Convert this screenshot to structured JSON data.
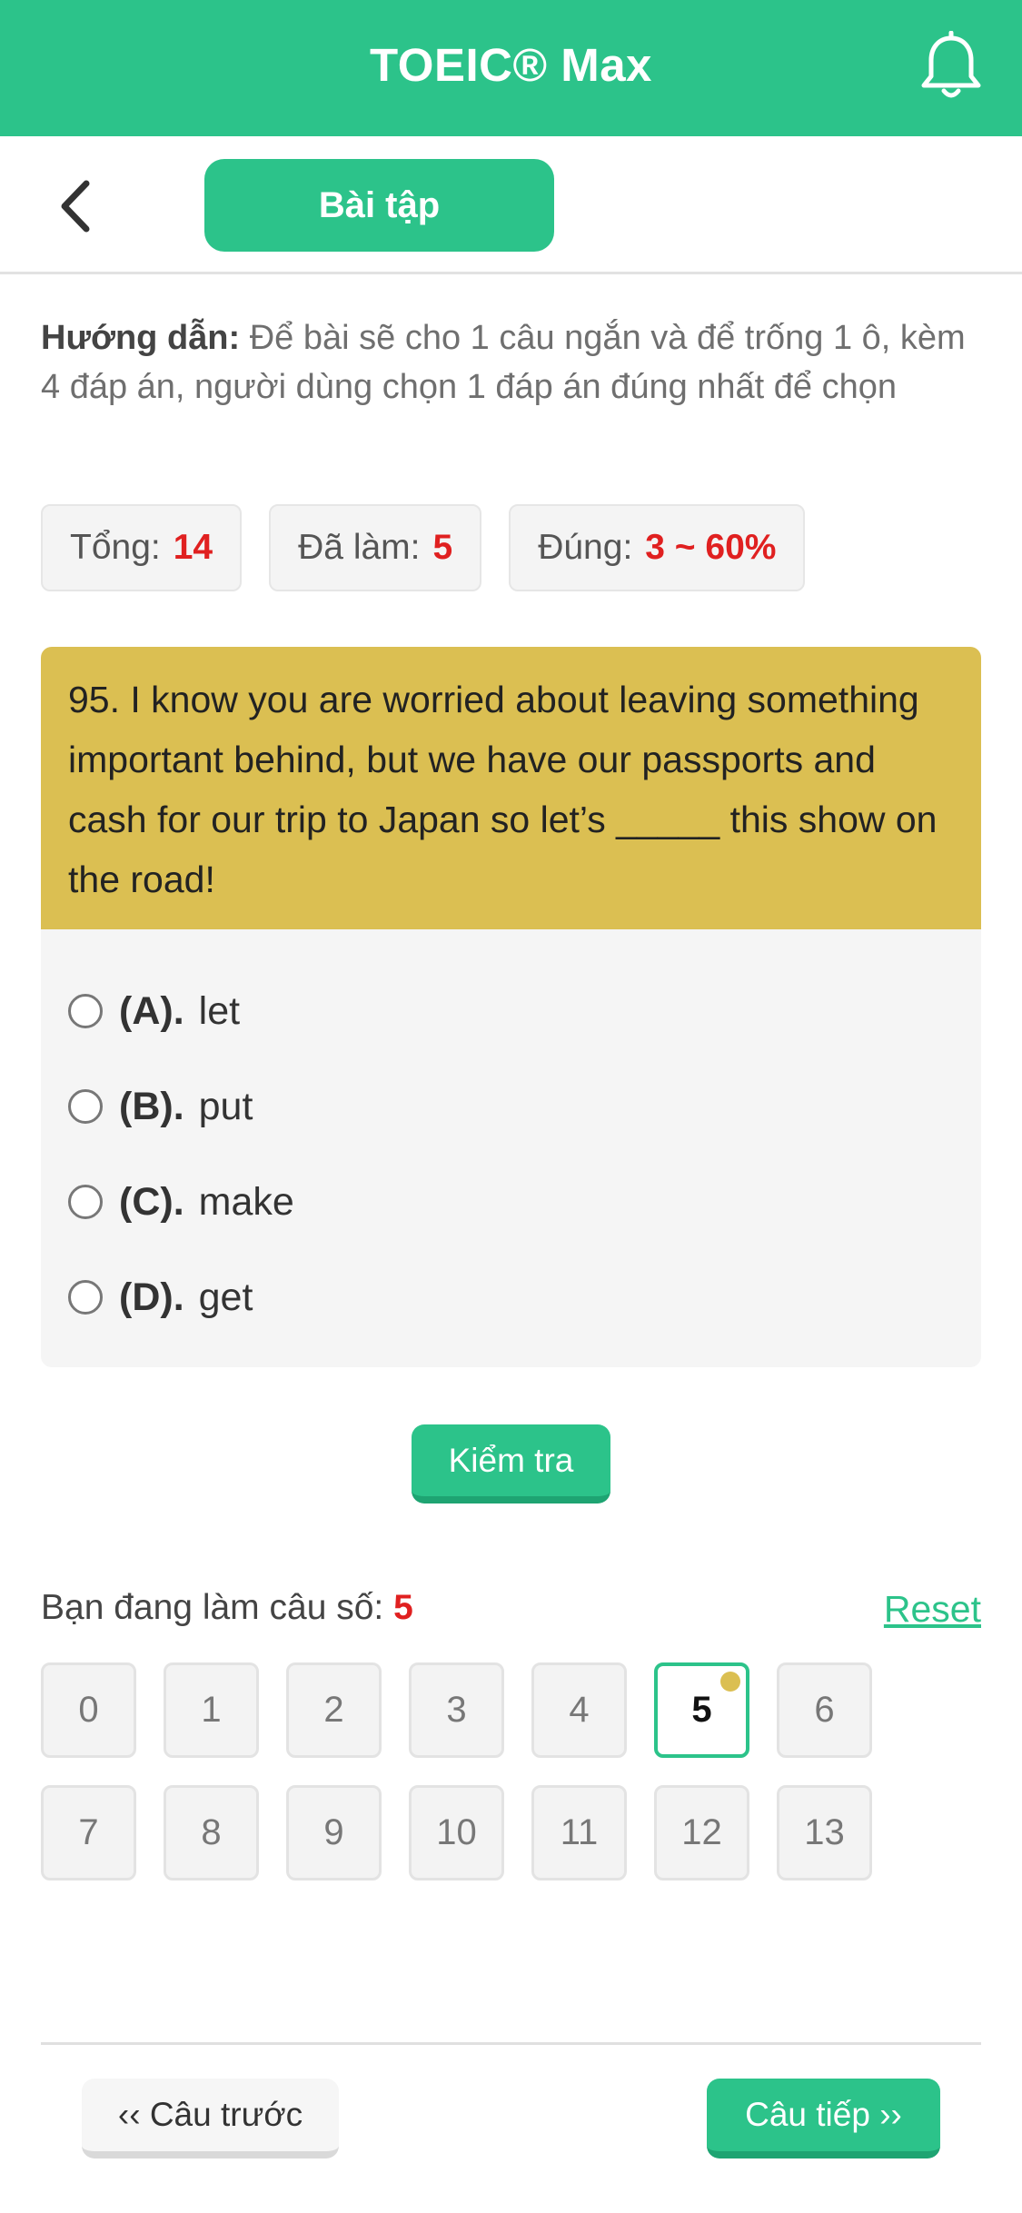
{
  "header": {
    "title": "TOEIC® Max",
    "bell_icon": "bell-icon"
  },
  "subbar": {
    "back_icon": "chevron-left-icon",
    "tab_label": "Bài tập"
  },
  "guide": {
    "label": "Hướng dẫn:",
    "text": " Để bài sẽ cho 1 câu ngắn và để trống 1 ô, kèm 4 đáp án, người dùng chọn 1 đáp án đúng nhất để chọn"
  },
  "stats": {
    "total_label": "Tổng:",
    "total_value": "14",
    "done_label": "Đã làm:",
    "done_value": "5",
    "correct_label": "Đúng:",
    "correct_value": "3 ~ 60%"
  },
  "question": {
    "text": "95. I know you are worried about leaving something important behind, but we have our passports and cash for our trip to Japan so let’s _____ this show on the road!",
    "options": [
      {
        "label": "(A).",
        "text": "let"
      },
      {
        "label": "(B).",
        "text": "put"
      },
      {
        "label": "(C).",
        "text": "make"
      },
      {
        "label": "(D).",
        "text": "get"
      }
    ]
  },
  "actions": {
    "check_label": "Kiểm tra",
    "reset_label": "Reset"
  },
  "progress": {
    "current_label": "Bạn đang làm câu số:",
    "current_value": "5",
    "numbers": [
      "0",
      "1",
      "2",
      "3",
      "4",
      "5",
      "6",
      "7",
      "8",
      "9",
      "10",
      "11",
      "12",
      "13"
    ],
    "active_index": 5
  },
  "nav": {
    "prev_label": "‹‹ Câu trước",
    "next_label": "Câu tiếp ››"
  },
  "colors": {
    "accent": "#2cc38a",
    "question_bg": "#dbbf52",
    "highlight": "#e02020"
  }
}
